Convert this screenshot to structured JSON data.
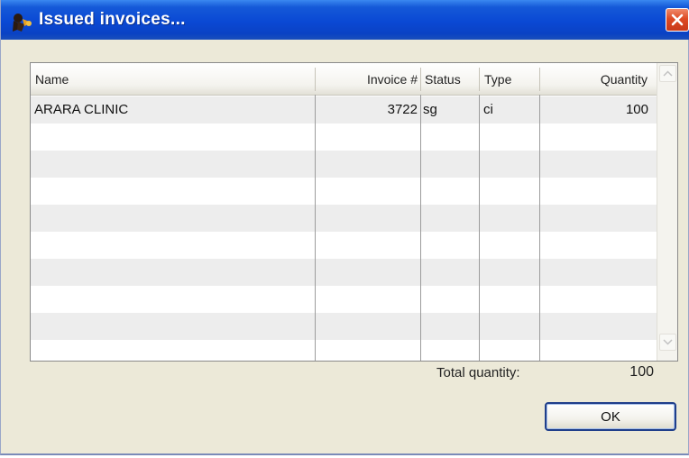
{
  "window": {
    "title": "Issued invoices...",
    "accent_color": "#0a48d4",
    "close_icon": "close-icon"
  },
  "grid": {
    "columns": [
      {
        "key": "name",
        "label": "Name"
      },
      {
        "key": "invoice_no",
        "label": "Invoice #"
      },
      {
        "key": "status",
        "label": "Status"
      },
      {
        "key": "type",
        "label": "Type"
      },
      {
        "key": "quantity",
        "label": "Quantity"
      }
    ],
    "rows": [
      {
        "name": "ARARA CLINIC",
        "invoice_no": "3722",
        "status": "sg",
        "type": "ci",
        "quantity": "100"
      }
    ]
  },
  "footer": {
    "total_label": "Total quantity:",
    "total_value": "100",
    "ok_label": "OK"
  }
}
